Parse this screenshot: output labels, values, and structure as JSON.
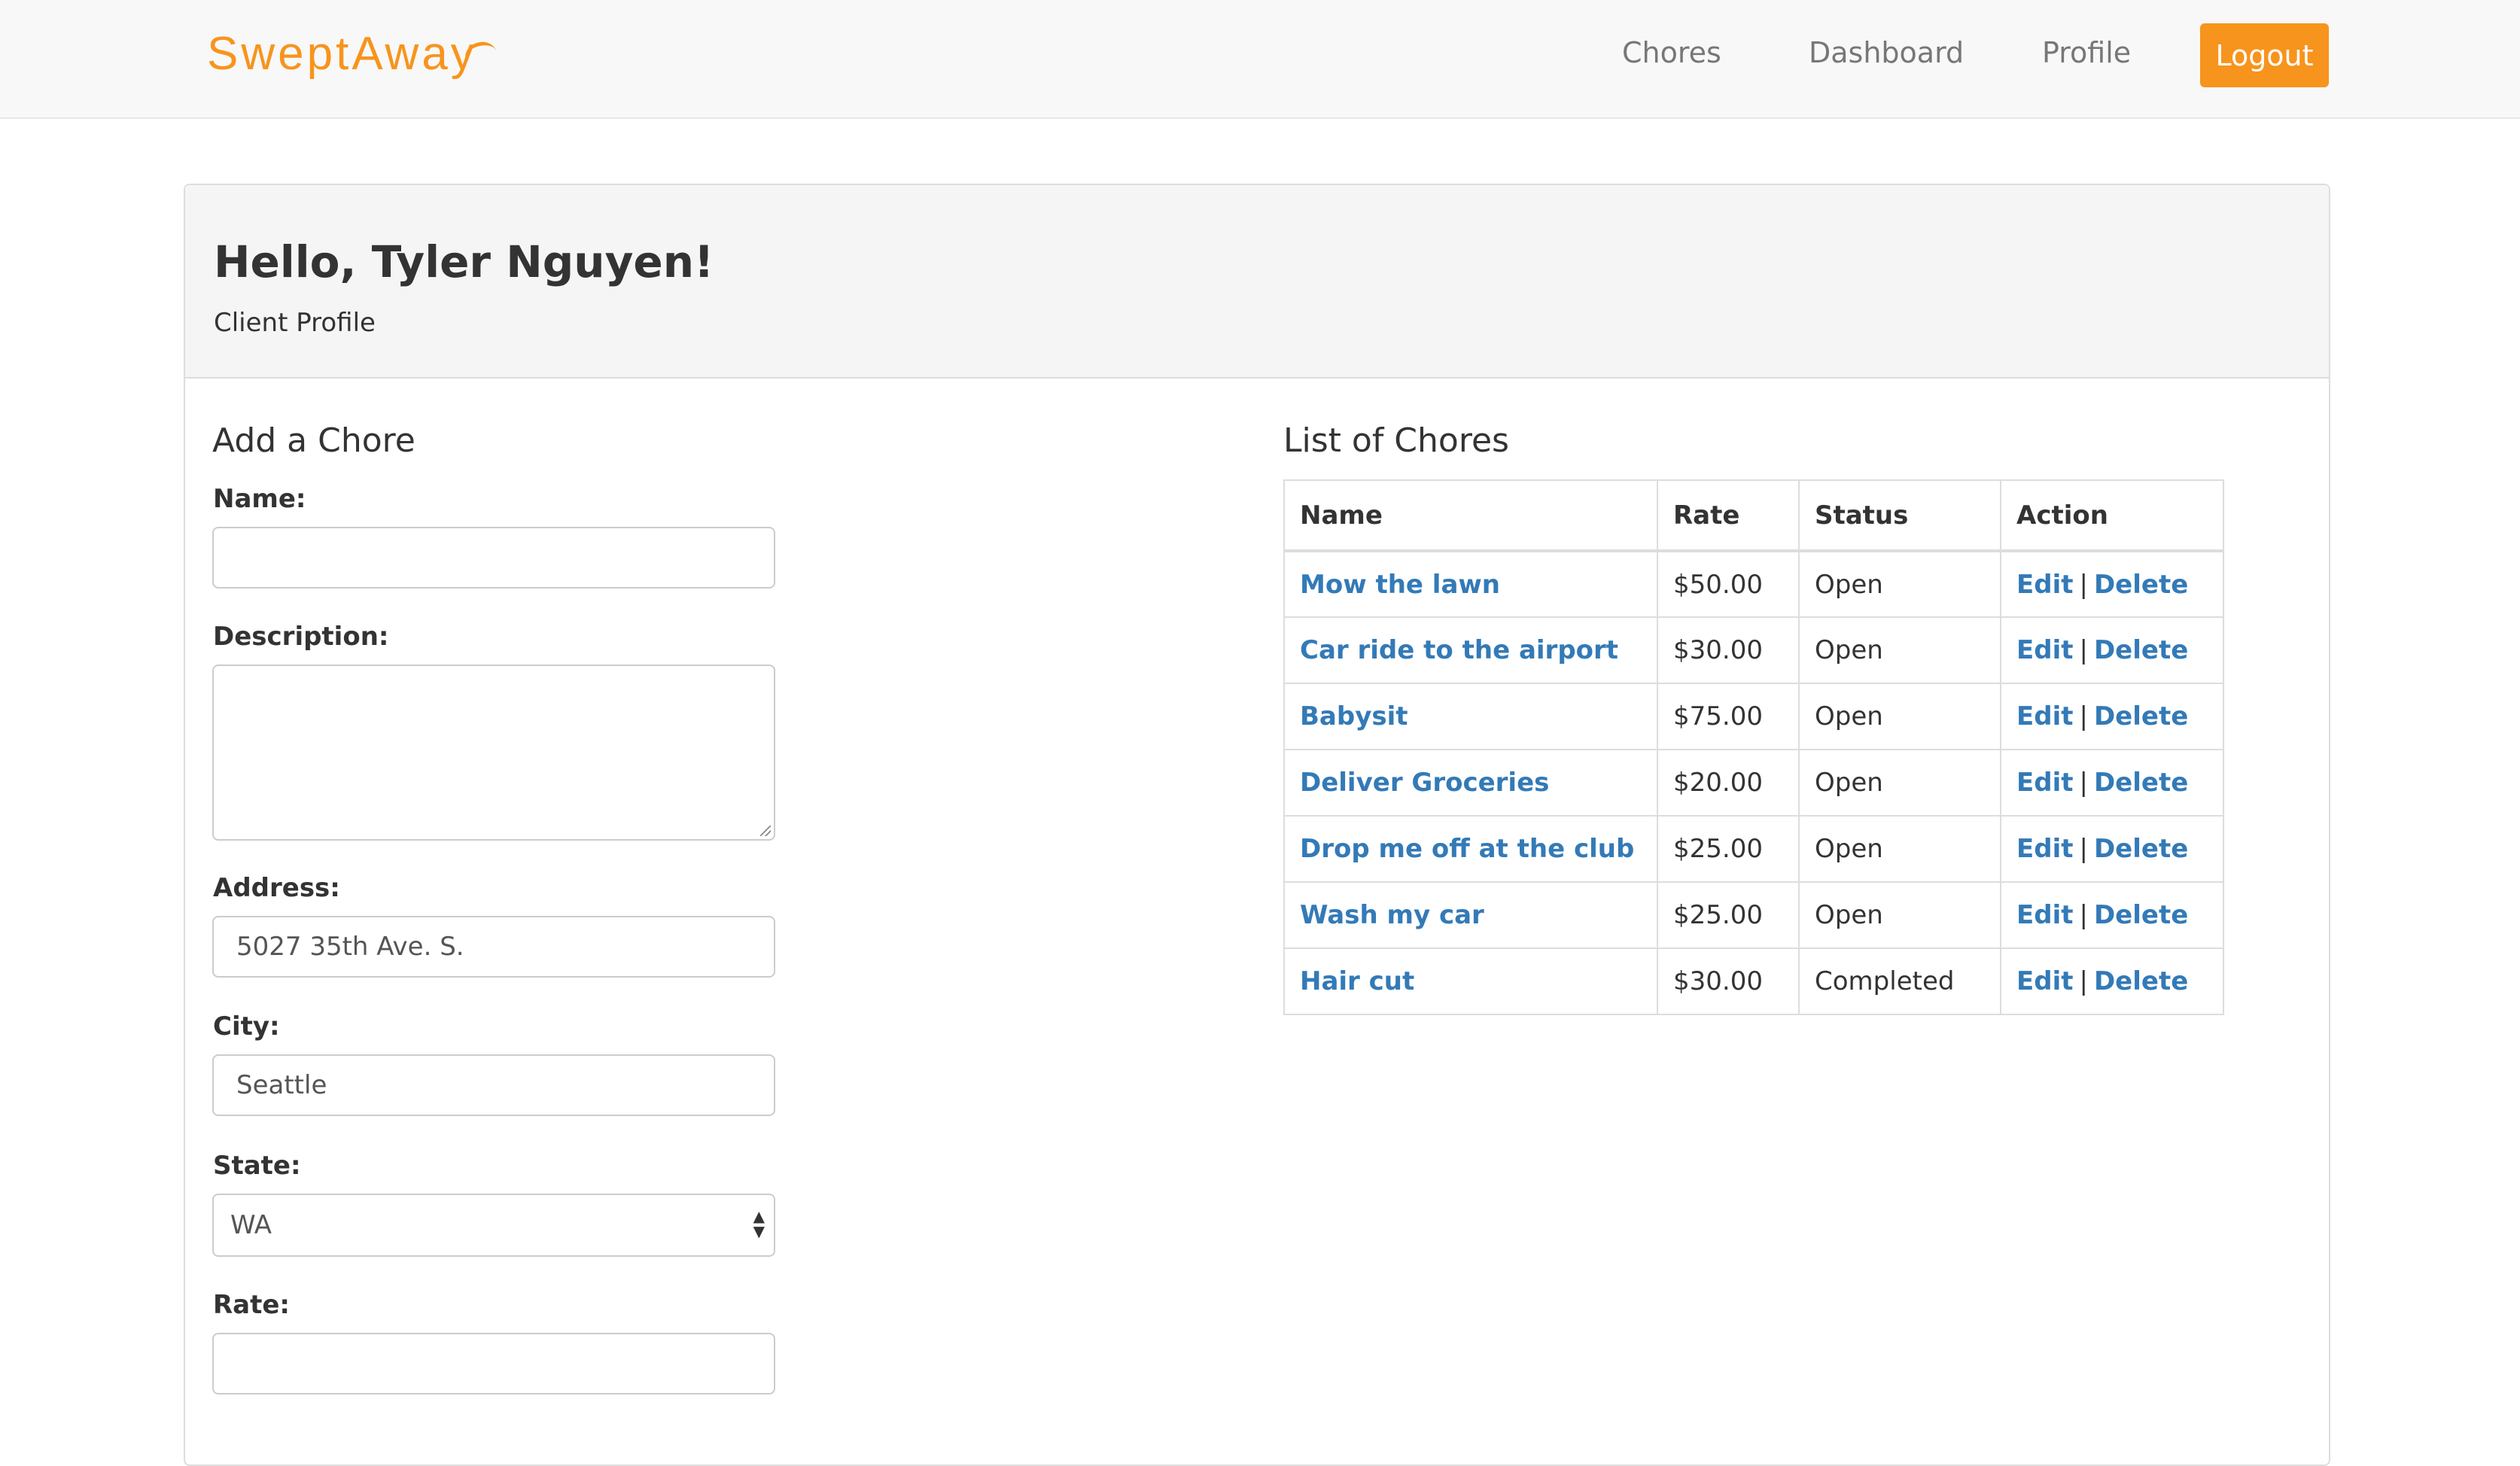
{
  "navbar": {
    "brand": "SweptAway",
    "links": [
      "Chores",
      "Dashboard",
      "Profile"
    ],
    "logout_label": "Logout",
    "accent_color": "#f7941d"
  },
  "header": {
    "greeting": "Hello, Tyler Nguyen!",
    "subtitle": "Client Profile"
  },
  "add_chore": {
    "title": "Add a Chore",
    "name_label": "Name:",
    "name_value": "",
    "description_label": "Description:",
    "description_value": "",
    "address_label": "Address:",
    "address_value": "5027 35th Ave. S.",
    "city_label": "City:",
    "city_value": "Seattle",
    "state_label": "State:",
    "state_value": "WA",
    "rate_label": "Rate:",
    "rate_value": ""
  },
  "chores": {
    "title": "List of Chores",
    "columns": [
      "Name",
      "Rate",
      "Status",
      "Action"
    ],
    "edit_label": "Edit",
    "delete_label": "Delete",
    "separator": "|",
    "rows": [
      {
        "name": "Mow the lawn",
        "rate": "$50.00",
        "status": "Open"
      },
      {
        "name": "Car ride to the airport",
        "rate": "$30.00",
        "status": "Open"
      },
      {
        "name": "Babysit",
        "rate": "$75.00",
        "status": "Open"
      },
      {
        "name": "Deliver Groceries",
        "rate": "$20.00",
        "status": "Open"
      },
      {
        "name": "Drop me off at the club",
        "rate": "$25.00",
        "status": "Open"
      },
      {
        "name": "Wash my car",
        "rate": "$25.00",
        "status": "Open"
      },
      {
        "name": "Hair cut",
        "rate": "$30.00",
        "status": "Completed"
      }
    ],
    "link_color": "#337ab7"
  }
}
